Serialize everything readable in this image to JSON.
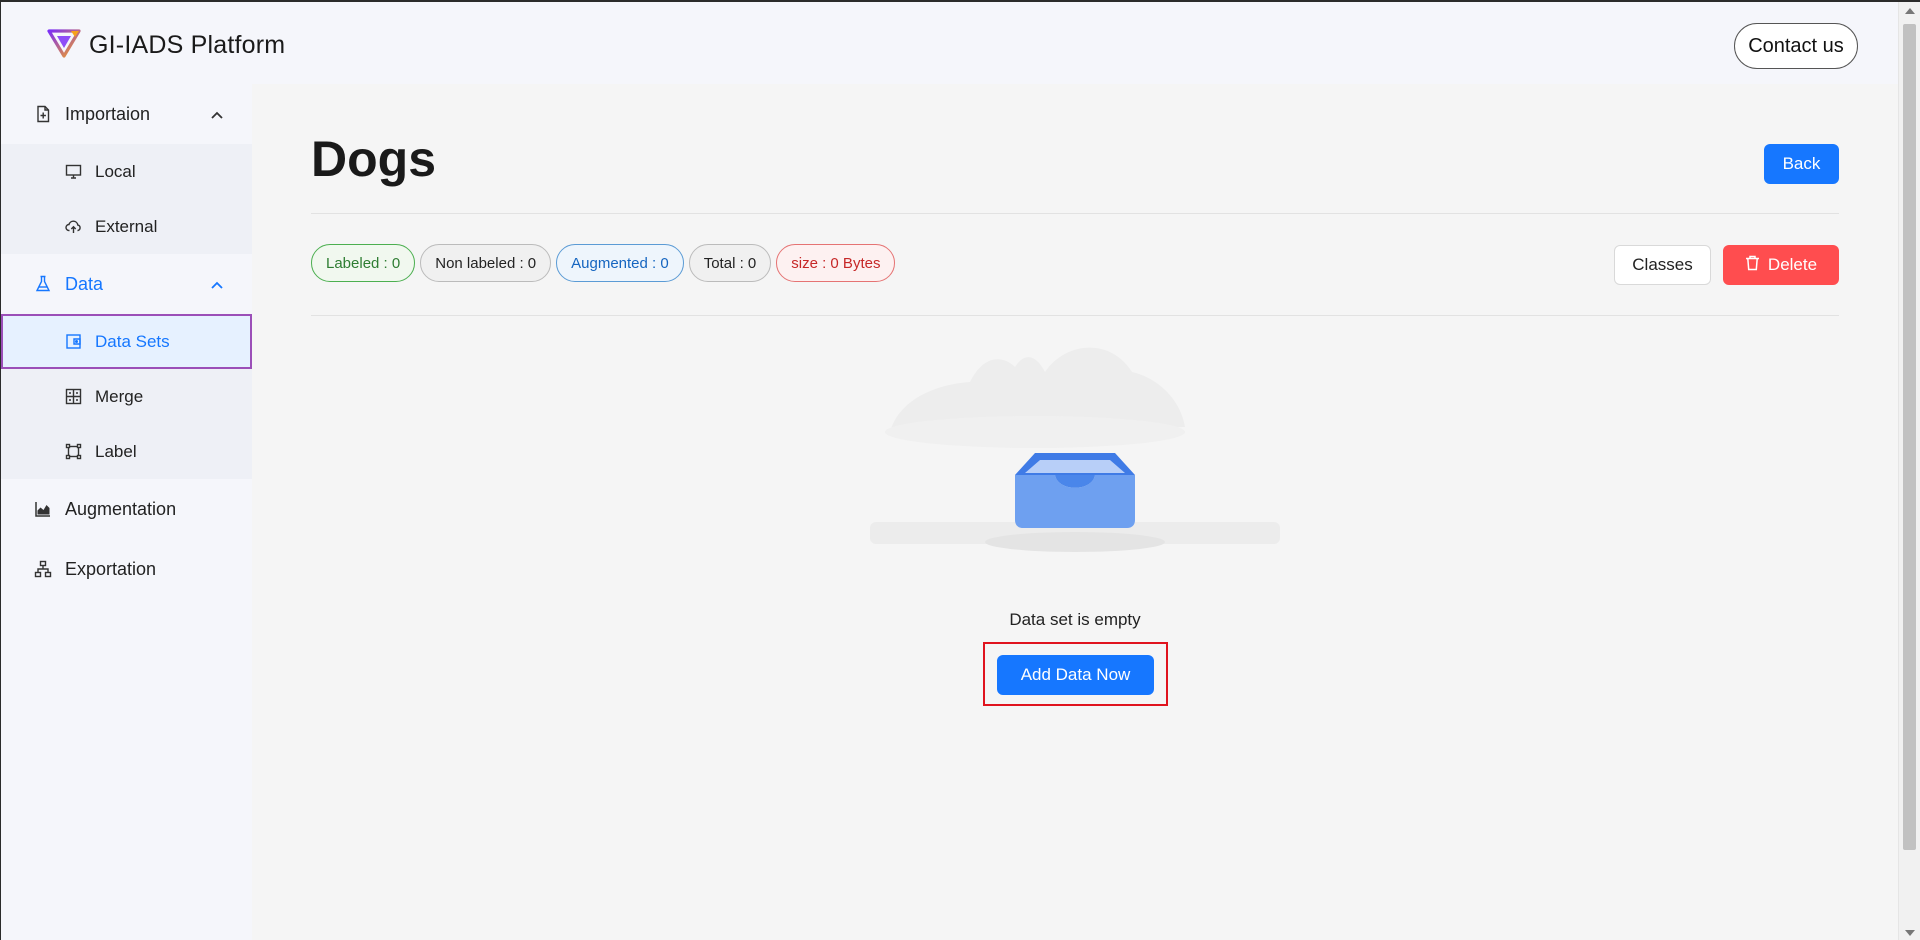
{
  "header": {
    "brand_name": "GI-IADS Platform",
    "contact_label": "Contact us"
  },
  "sidebar": {
    "groups": [
      {
        "label": "Importaion",
        "icon": "file-import-icon",
        "expanded": true,
        "items": [
          {
            "label": "Local",
            "icon": "monitor-icon"
          },
          {
            "label": "External",
            "icon": "cloud-upload-icon"
          }
        ]
      },
      {
        "label": "Data",
        "icon": "flask-icon",
        "expanded": true,
        "active": true,
        "items": [
          {
            "label": "Data Sets",
            "icon": "dataset-icon",
            "selected": true
          },
          {
            "label": "Merge",
            "icon": "merge-icon"
          },
          {
            "label": "Label",
            "icon": "label-icon"
          }
        ]
      },
      {
        "label": "Augmentation",
        "icon": "area-chart-icon"
      },
      {
        "label": "Exportation",
        "icon": "sitemap-icon"
      }
    ]
  },
  "main": {
    "title": "Dogs",
    "back_label": "Back",
    "tags": [
      {
        "label": "Labeled : 0",
        "color": "#2e7d32"
      },
      {
        "label": "Non labeled : 0",
        "color": "#222222"
      },
      {
        "label": "Augmented : 0",
        "color": "#1565c0"
      },
      {
        "label": "Total : 0",
        "color": "#222222"
      },
      {
        "label": "size : 0 Bytes",
        "color": "#c62828"
      }
    ],
    "classes_label": "Classes",
    "delete_label": "Delete",
    "empty_text": "Data set is empty",
    "add_label": "Add Data Now"
  },
  "colors": {
    "accent": "#1677ff",
    "danger": "#ff4d4f",
    "highlight_outline": "#9b4fb8",
    "annotation_box": "#e0141e"
  }
}
